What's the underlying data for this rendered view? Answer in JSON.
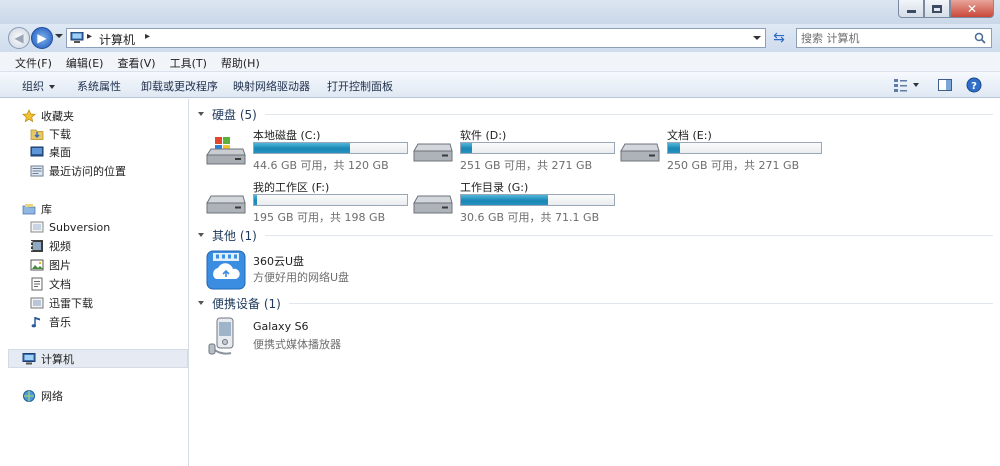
{
  "addressbar": {
    "path": "计算机",
    "search_placeholder": "搜索 计算机"
  },
  "menubar": {
    "items": [
      "文件(F)",
      "编辑(E)",
      "查看(V)",
      "工具(T)",
      "帮助(H)"
    ]
  },
  "toolbar": {
    "organize": "组织",
    "system_properties": "系统属性",
    "uninstall": "卸载或更改程序",
    "map_drive": "映射网络驱动器",
    "control_panel": "打开控制面板"
  },
  "sidebar": {
    "favorites": "收藏夹",
    "favorites_items": [
      "下载",
      "桌面",
      "最近访问的位置"
    ],
    "libraries": "库",
    "library_items": [
      "Subversion",
      "视频",
      "图片",
      "文档",
      "迅雷下载",
      "音乐"
    ],
    "computer": "计算机",
    "network": "网络"
  },
  "content": {
    "groups": {
      "hard_disks": "硬盘 (5)",
      "other": "其他 (1)",
      "portable": "便携设备 (1)"
    },
    "drives": [
      {
        "name": "本地磁盘 (C:)",
        "size": "44.6 GB 可用，共 120 GB",
        "used_fraction": 0.63
      },
      {
        "name": "软件 (D:)",
        "size": "251 GB 可用，共 271 GB",
        "used_fraction": 0.07
      },
      {
        "name": "文档 (E:)",
        "size": "250 GB 可用，共 271 GB",
        "used_fraction": 0.08
      },
      {
        "name": "我的工作区 (F:)",
        "size": "195 GB 可用，共 198 GB",
        "used_fraction": 0.02
      },
      {
        "name": "工作目录 (G:)",
        "size": "30.6 GB 可用，共 71.1 GB",
        "used_fraction": 0.57
      }
    ],
    "other_item": {
      "name": "360云U盘",
      "desc": "方便好用的网络U盘"
    },
    "portable_item": {
      "name": "Galaxy S6",
      "desc": "便携式媒体播放器"
    }
  },
  "colors": {
    "usage_bar": "#1a86b4",
    "selection": "#e6ebf3",
    "annotation_mark": "#e21d1d"
  }
}
